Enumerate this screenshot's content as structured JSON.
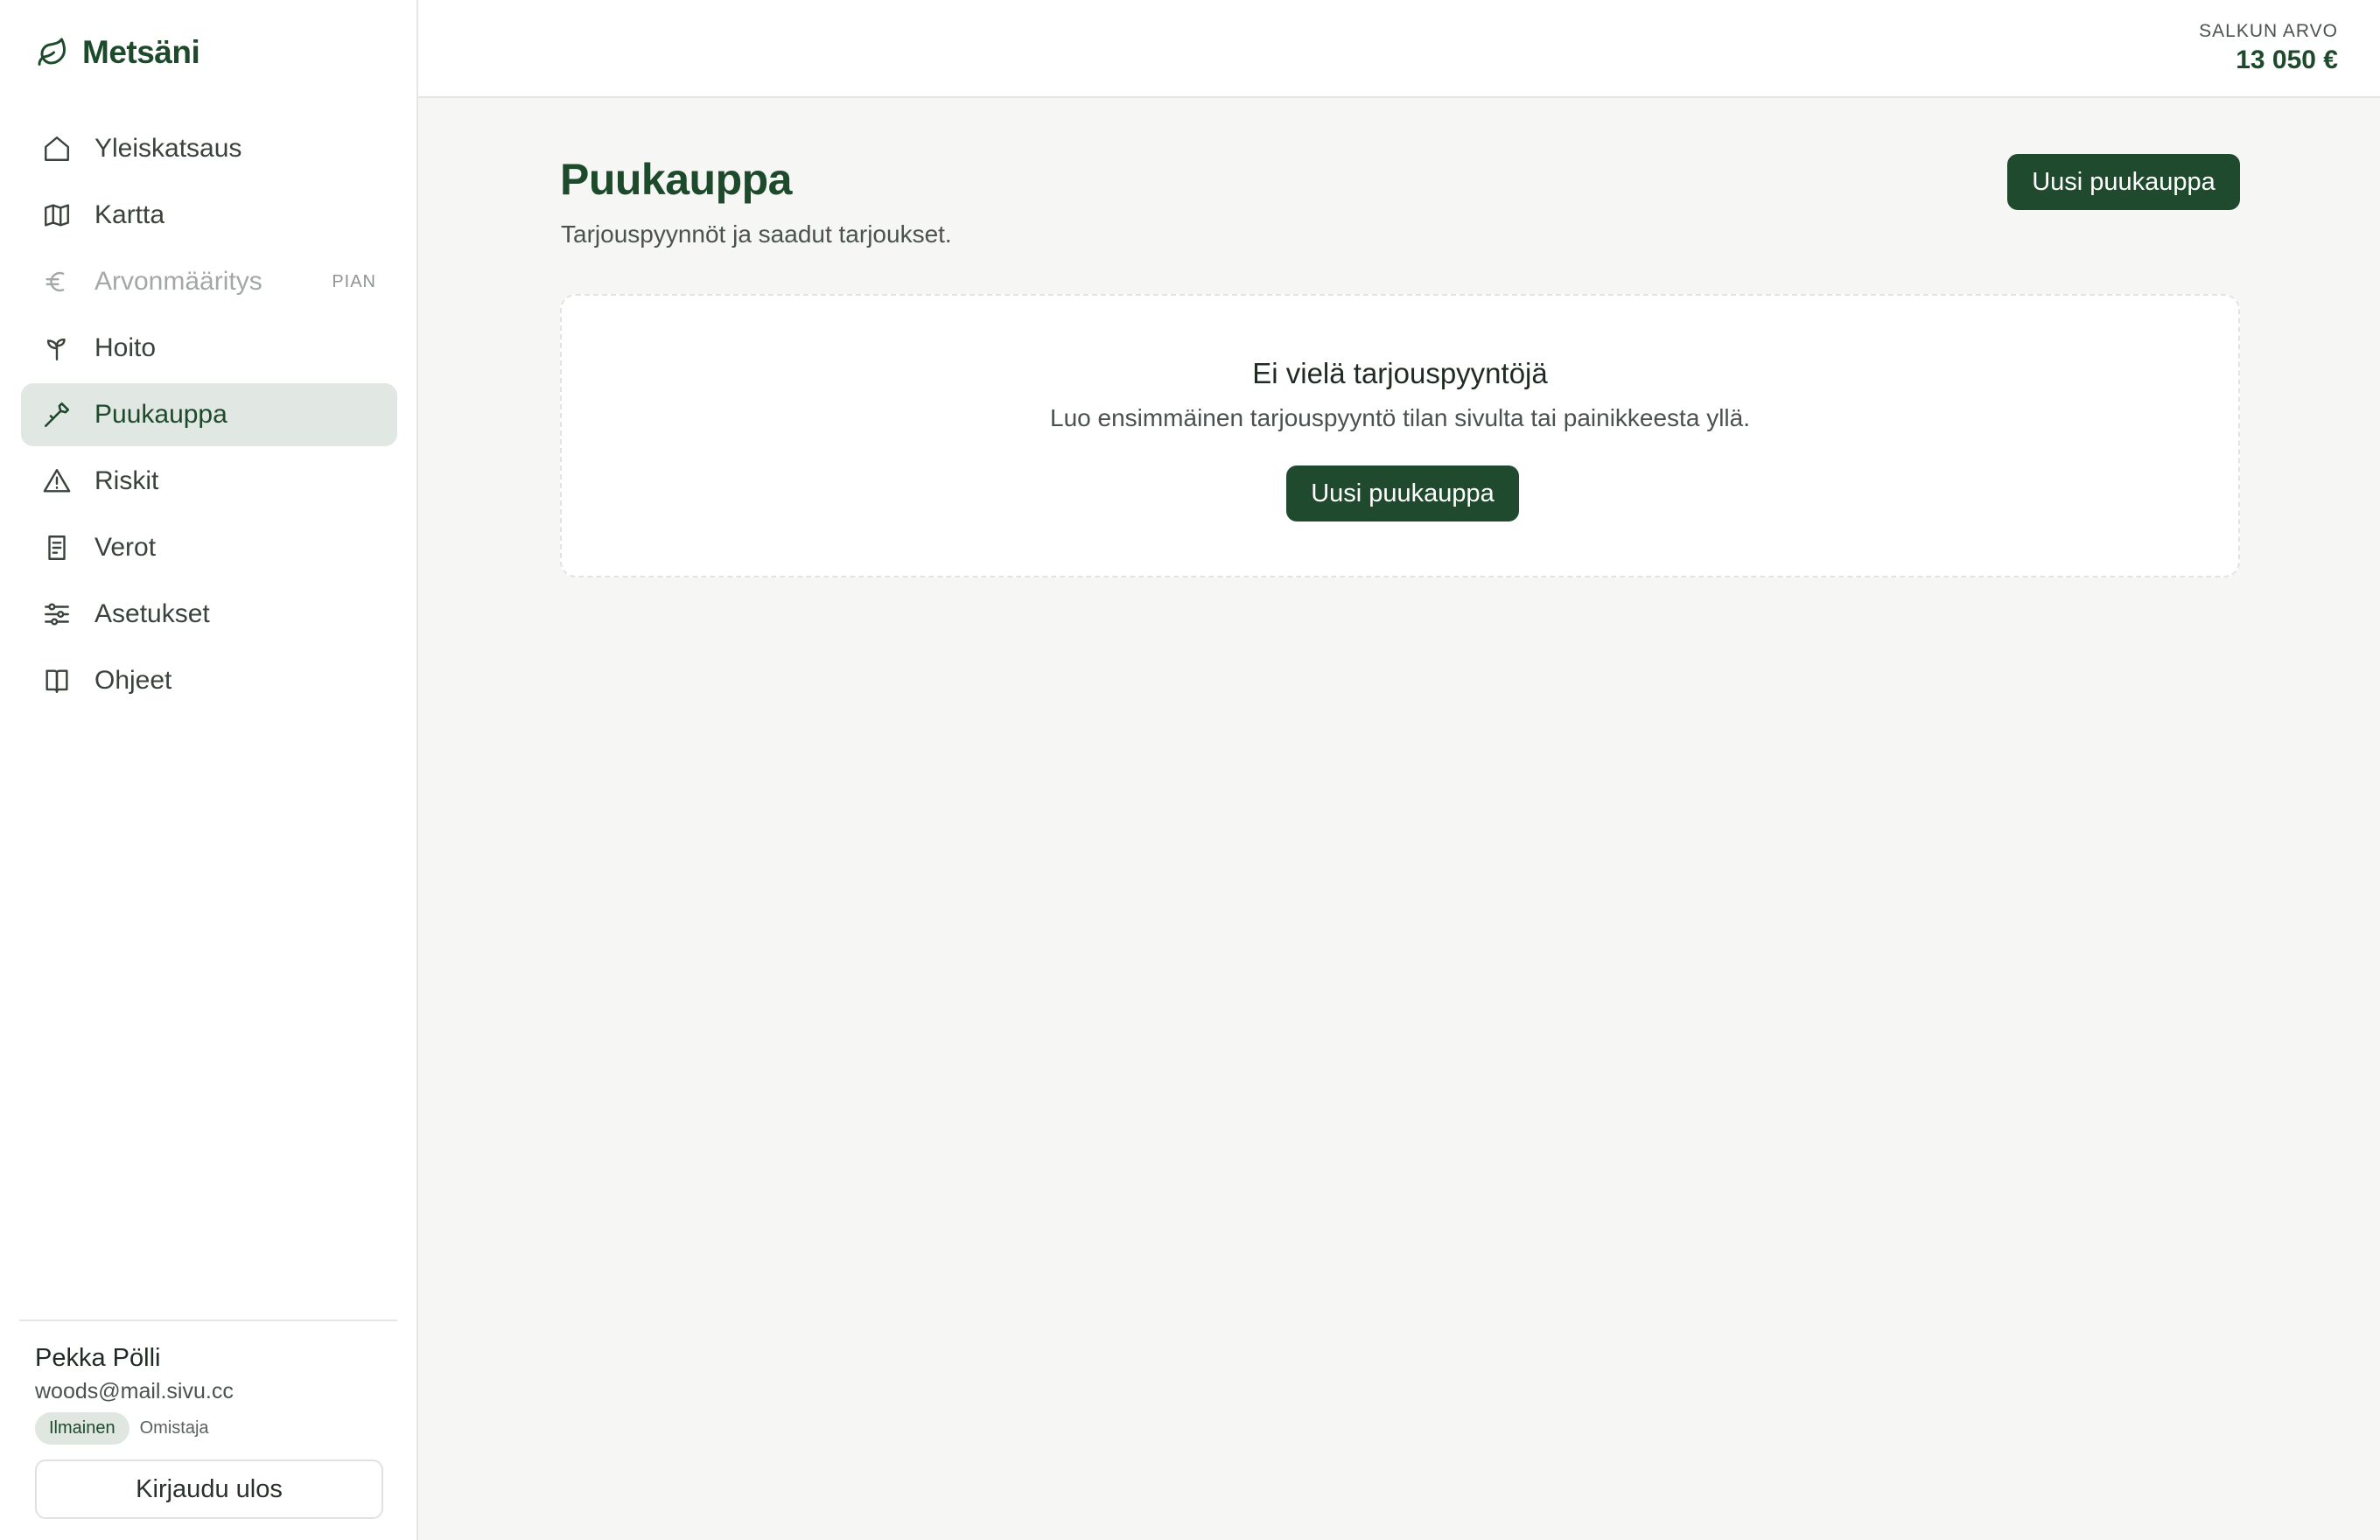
{
  "brand": {
    "name": "Metsäni",
    "icon": "leaf-icon"
  },
  "sidebar": {
    "items": [
      {
        "label": "Yleiskatsaus",
        "icon": "home-icon"
      },
      {
        "label": "Kartta",
        "icon": "map-icon"
      },
      {
        "label": "Arvonmääritys",
        "icon": "euro-icon",
        "badge": "PIAN",
        "disabled": true
      },
      {
        "label": "Hoito",
        "icon": "sprout-icon"
      },
      {
        "label": "Puukauppa",
        "icon": "axe-icon",
        "active": true
      },
      {
        "label": "Riskit",
        "icon": "warning-icon"
      },
      {
        "label": "Verot",
        "icon": "receipt-icon"
      },
      {
        "label": "Asetukset",
        "icon": "sliders-icon"
      },
      {
        "label": "Ohjeet",
        "icon": "book-icon"
      }
    ]
  },
  "user": {
    "name": "Pekka Pölli",
    "email": "woods@mail.sivu.cc",
    "plan": "Ilmainen",
    "role": "Omistaja",
    "logout_label": "Kirjaudu ulos"
  },
  "header": {
    "portfolio_label": "SALKUN ARVO",
    "portfolio_value": "13 050 €"
  },
  "main": {
    "title": "Puukauppa",
    "subtitle": "Tarjouspyynnöt ja saadut tarjoukset.",
    "new_button_label": "Uusi puukauppa",
    "empty": {
      "title": "Ei vielä tarjouspyyntöjä",
      "text": "Luo ensimmäinen tarjouspyyntö tilan sivulta tai painikkeesta yllä.",
      "button_label": "Uusi puukauppa"
    }
  },
  "colors": {
    "brand_green": "#1e4a2c",
    "button_green": "#1f4a2d",
    "active_bg": "#e1e7e2",
    "page_bg": "#f6f6f4"
  }
}
